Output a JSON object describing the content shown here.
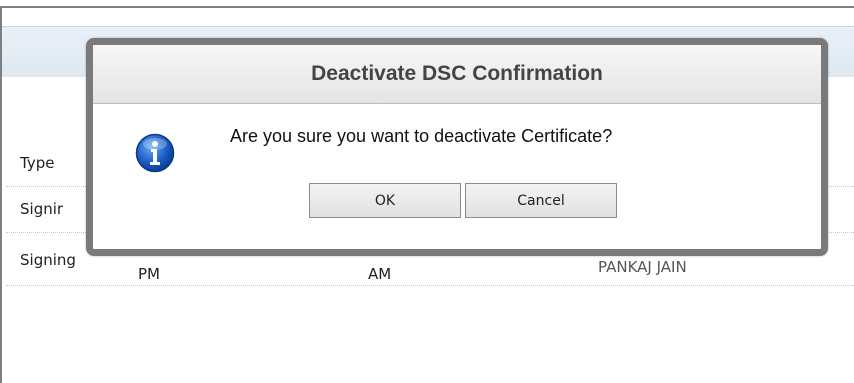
{
  "table": {
    "header_type": "Type",
    "row1_type": "Signir",
    "row2_type": "Signing",
    "row2_col2": "PM",
    "row2_col3": "AM",
    "row2_col4": "PANKAJ JAIN"
  },
  "dialog": {
    "title": "Deactivate DSC Confirmation",
    "message": "Are you sure you want to deactivate Certificate?",
    "ok_label": "OK",
    "cancel_label": "Cancel",
    "icon": "info-icon"
  },
  "colors": {
    "dialog_border": "#7a7a7a",
    "icon_blue": "#1a5fb4",
    "header_bar": "#e9f0f7"
  }
}
